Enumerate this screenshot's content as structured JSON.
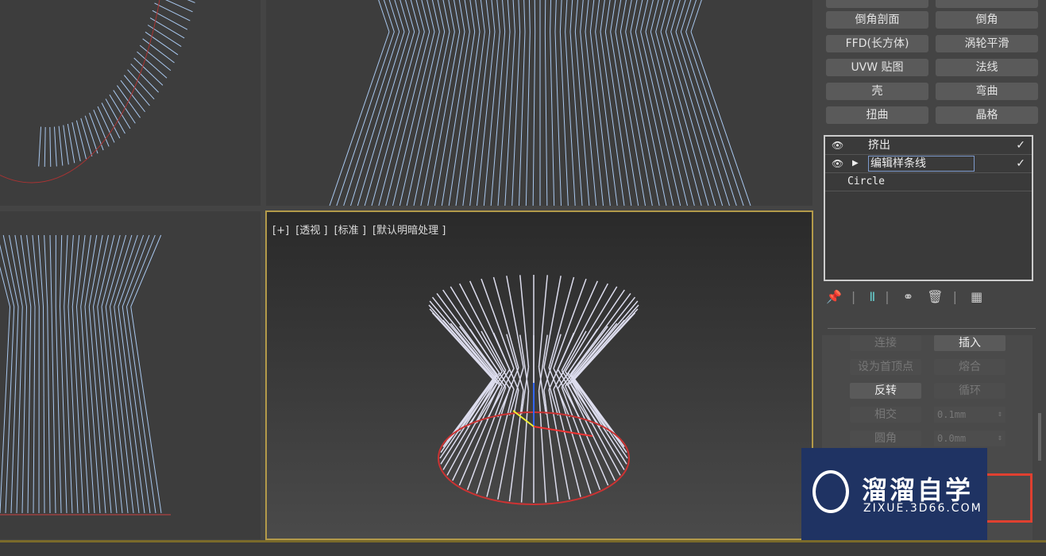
{
  "viewport_perspective": {
    "labels": [
      "[+]",
      "[透视 ]",
      "[标准 ]",
      "[默认明暗处理 ]"
    ]
  },
  "modifier_buttons": [
    [
      "倒角剖面",
      "倒角"
    ],
    [
      "FFD(长方体)",
      "涡轮平滑"
    ],
    [
      "UVW 贴图",
      "法线"
    ],
    [
      "壳",
      "弯曲"
    ],
    [
      "扭曲",
      "晶格"
    ]
  ],
  "modifier_stack": [
    {
      "label": "挤出",
      "eye": true,
      "expand": false,
      "selected": false
    },
    {
      "label": "编辑样条线",
      "eye": true,
      "expand": true,
      "selected": true
    },
    {
      "label": "Circle",
      "eye": false,
      "expand": false,
      "selected": false
    }
  ],
  "stack_tools": [
    "pin-icon",
    "show-end-result-icon",
    "make-unique-icon",
    "remove-modifier-icon",
    "configure-sets-icon"
  ],
  "geometry": {
    "rows": [
      {
        "left": {
          "label": "连接",
          "enabled": false
        },
        "right": {
          "label": "插入",
          "enabled": true
        }
      },
      {
        "left": {
          "label": "设为首顶点",
          "enabled": false
        },
        "right": {
          "label": "熔合",
          "enabled": false
        }
      },
      {
        "left": {
          "label": "反转",
          "enabled": true
        },
        "right": {
          "label": "循环",
          "enabled": false
        }
      },
      {
        "left": {
          "label": "相交",
          "enabled": false
        },
        "right": {
          "spinner": "0.1mm"
        }
      },
      {
        "left": {
          "label": "圆角",
          "enabled": false
        },
        "right": {
          "spinner": "0.0mm"
        }
      }
    ]
  },
  "watermark": {
    "title": "溜溜自学",
    "url": "ZIXUE.3D66.COM"
  },
  "colors": {
    "wire": "#a9c8ef",
    "active_border": "#b39a4a",
    "highlight": "#e04030"
  }
}
